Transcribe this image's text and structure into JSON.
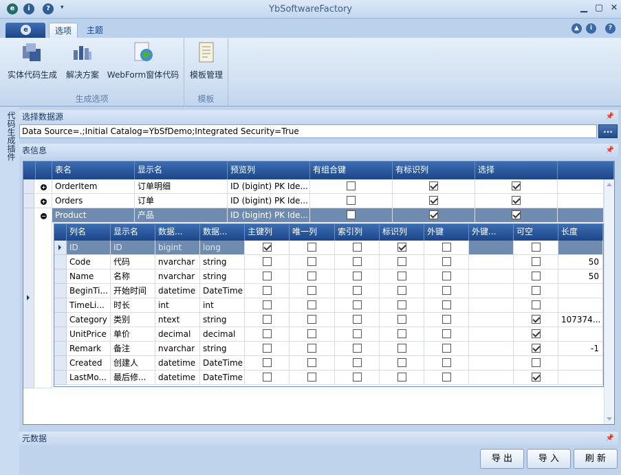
{
  "window": {
    "title": "YbSoftwareFactory"
  },
  "ribbon_tabs": [
    {
      "label": "选项"
    },
    {
      "label": "主题"
    }
  ],
  "ribbon_groups": [
    {
      "label": "生成选项",
      "buttons": [
        {
          "label": "实体代码生成",
          "icon": "entity-icon"
        },
        {
          "label": "解决方案",
          "icon": "solution-icon"
        },
        {
          "label": "WebForm窗体代码",
          "icon": "webform-icon"
        }
      ]
    },
    {
      "label": "模板",
      "buttons": [
        {
          "label": "模板管理",
          "icon": "template-icon"
        }
      ]
    }
  ],
  "side_panel": {
    "label": "代码生成插件"
  },
  "datasource": {
    "header": "选择数据源",
    "value": "Data Source=.;Initial Catalog=YbSfDemo;Integrated Security=True",
    "browse": "..."
  },
  "table_info": {
    "header": "表信息",
    "columns": [
      "表名",
      "显示名",
      "预览列",
      "有组合键",
      "有标识列",
      "选择"
    ],
    "rows": [
      {
        "name": "OrderItem",
        "display": "订单明细",
        "preview": "ID (bigint) PK Ide...",
        "composite_key": false,
        "identity": true,
        "select": true
      },
      {
        "name": "Orders",
        "display": "订单",
        "preview": "ID (bigint) PK Ide...",
        "composite_key": false,
        "identity": true,
        "select": true
      },
      {
        "name": "Product",
        "display": "产品",
        "preview": "ID (bigint) PK Ide...",
        "composite_key": false,
        "identity": true,
        "select": true
      }
    ],
    "detail_columns": [
      "列名",
      "显示名",
      "数据...",
      "数据...",
      "主键列",
      "唯一列",
      "索引列",
      "标识列",
      "外键",
      "外键...",
      "可空",
      "长度"
    ],
    "detail_rows": [
      {
        "col": "ID",
        "display": "ID",
        "dbtype": "bigint",
        "type": "long",
        "pk": true,
        "unique": false,
        "index": false,
        "identity": true,
        "fk": false,
        "fk_table": "",
        "nullable": false,
        "length": ""
      },
      {
        "col": "Code",
        "display": "代码",
        "dbtype": "nvarchar",
        "type": "string",
        "pk": false,
        "unique": false,
        "index": false,
        "identity": false,
        "fk": false,
        "fk_table": "",
        "nullable": false,
        "length": "50"
      },
      {
        "col": "Name",
        "display": "名称",
        "dbtype": "nvarchar",
        "type": "string",
        "pk": false,
        "unique": false,
        "index": false,
        "identity": false,
        "fk": false,
        "fk_table": "",
        "nullable": false,
        "length": "50"
      },
      {
        "col": "BeginTi...",
        "display": "开始时间",
        "dbtype": "datetime",
        "type": "DateTime",
        "pk": false,
        "unique": false,
        "index": false,
        "identity": false,
        "fk": false,
        "fk_table": "",
        "nullable": false,
        "length": ""
      },
      {
        "col": "TimeLi...",
        "display": "时长",
        "dbtype": "int",
        "type": "int",
        "pk": false,
        "unique": false,
        "index": false,
        "identity": false,
        "fk": false,
        "fk_table": "",
        "nullable": false,
        "length": ""
      },
      {
        "col": "Category",
        "display": "类别",
        "dbtype": "ntext",
        "type": "string",
        "pk": false,
        "unique": false,
        "index": false,
        "identity": false,
        "fk": false,
        "fk_table": "",
        "nullable": true,
        "length": "107374..."
      },
      {
        "col": "UnitPrice",
        "display": "单价",
        "dbtype": "decimal",
        "type": "decimal",
        "pk": false,
        "unique": false,
        "index": false,
        "identity": false,
        "fk": false,
        "fk_table": "",
        "nullable": true,
        "length": ""
      },
      {
        "col": "Remark",
        "display": "备注",
        "dbtype": "nvarchar",
        "type": "string",
        "pk": false,
        "unique": false,
        "index": false,
        "identity": false,
        "fk": false,
        "fk_table": "",
        "nullable": true,
        "length": "-1"
      },
      {
        "col": "Created",
        "display": "创建人",
        "dbtype": "datetime",
        "type": "DateTime",
        "pk": false,
        "unique": false,
        "index": false,
        "identity": false,
        "fk": false,
        "fk_table": "",
        "nullable": false,
        "length": ""
      },
      {
        "col": "LastMo...",
        "display": "最后修...",
        "dbtype": "datetime",
        "type": "DateTime",
        "pk": false,
        "unique": false,
        "index": false,
        "identity": false,
        "fk": false,
        "fk_table": "",
        "nullable": true,
        "length": ""
      }
    ]
  },
  "metadata_panel": {
    "header": "元数据"
  },
  "actions": [
    {
      "label": "导 出"
    },
    {
      "label": "导 入"
    },
    {
      "label": "刷 新"
    }
  ],
  "colors": {
    "accent": "#1c4688",
    "selected_row": "#6f8bb0",
    "ribbon_bg": "#cfdff2"
  }
}
